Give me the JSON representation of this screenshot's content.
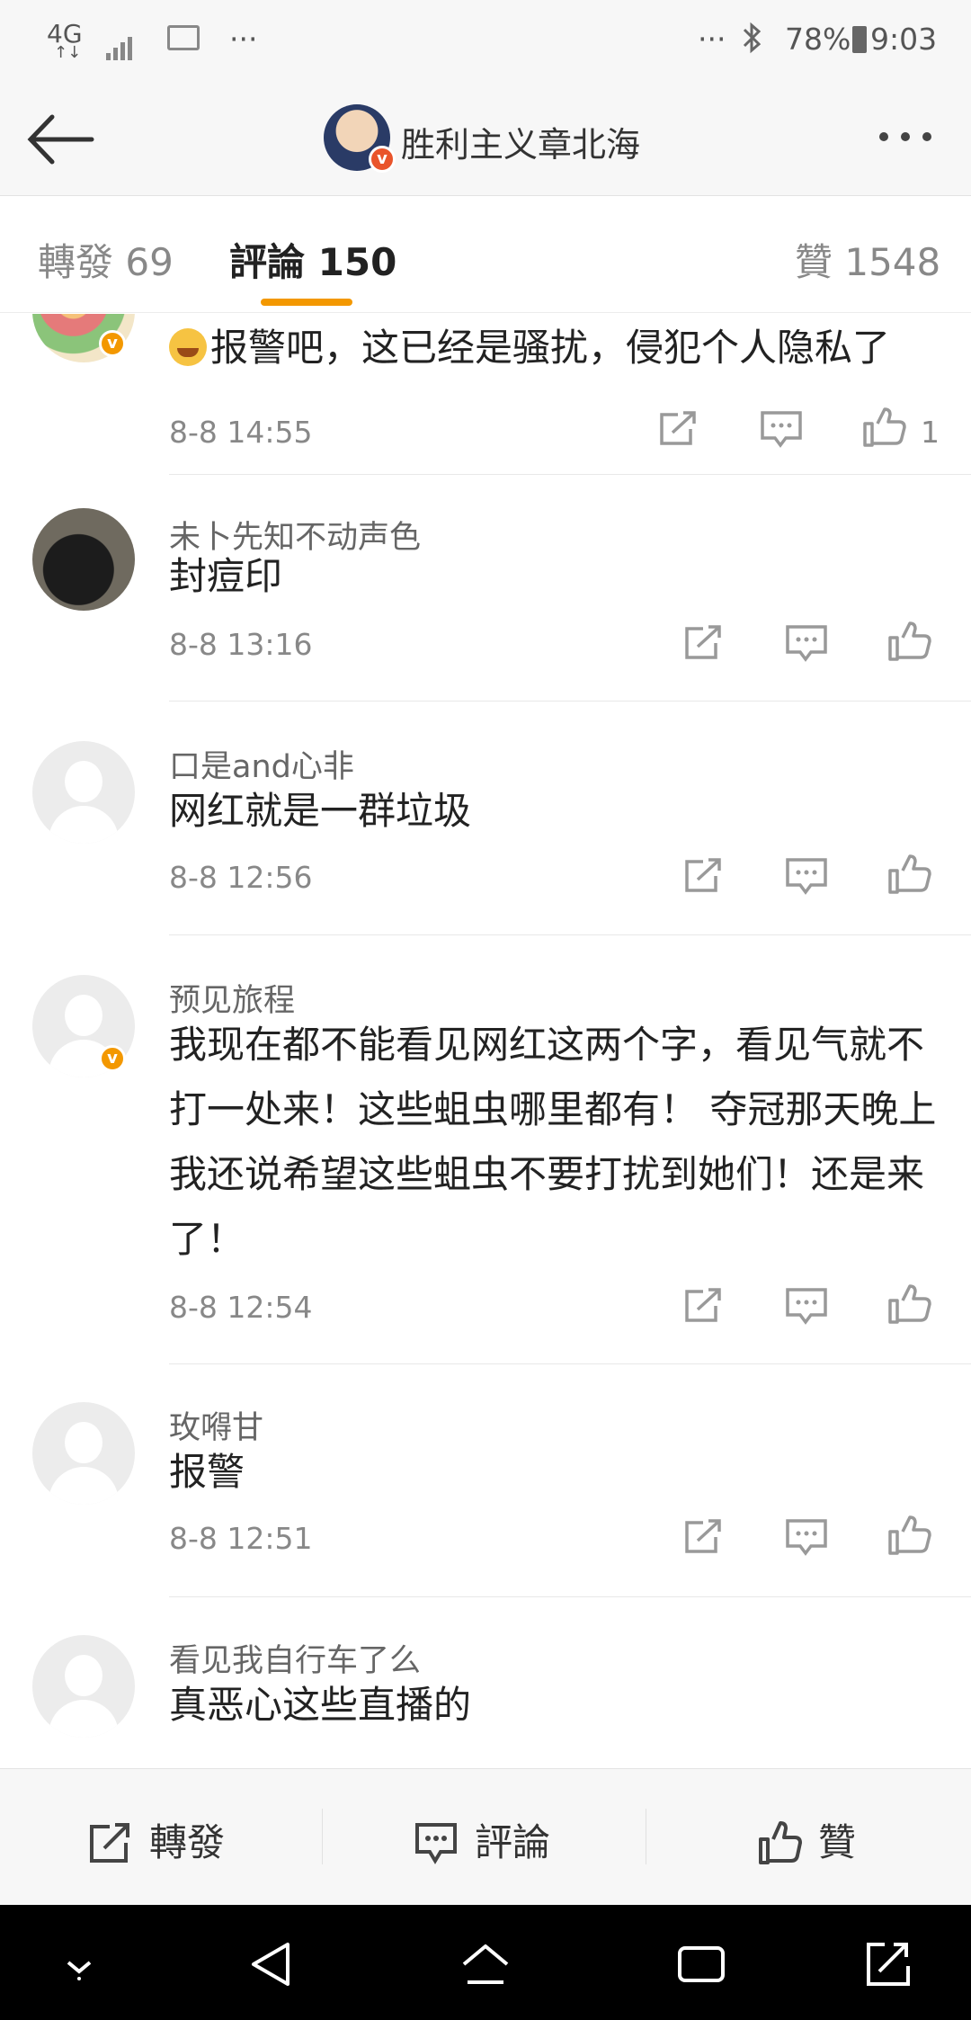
{
  "status_bar": {
    "network": "4G",
    "network_sub": "↑↓",
    "dots_left": "···",
    "dots_right": "···",
    "battery": "78%",
    "time": "9:03"
  },
  "header": {
    "title": "胜利主义章北海"
  },
  "tabs": [
    {
      "label": "轉發 69"
    },
    {
      "label": "評論 150"
    },
    {
      "label": "贊 1548"
    }
  ],
  "comments": [
    {
      "name": "",
      "text": "报警吧，这已经是骚扰，侵犯个人隐私了",
      "date": "8-8 14:55",
      "likes": "1",
      "verified": true,
      "avatar": "colorful"
    },
    {
      "name": "未卜先知不动声色",
      "text": "封痘印",
      "date": "8-8 13:16",
      "likes": "",
      "verified": false,
      "avatar": "cat"
    },
    {
      "name": "口是and心非",
      "text": "网红就是一群垃圾",
      "date": "8-8 12:56",
      "likes": "",
      "verified": false,
      "avatar": "default"
    },
    {
      "name": "预见旅程",
      "text": "我现在都不能看见网红这两个字，看见气就不打一处来！这些蛆虫哪里都有！ 夺冠那天晚上我还说希望这些蛆虫不要打扰到她们！还是来了！",
      "date": "8-8 12:54",
      "likes": "",
      "verified": true,
      "avatar": "default"
    },
    {
      "name": "玫嘚甘",
      "text": "报警",
      "date": "8-8 12:51",
      "likes": "",
      "verified": false,
      "avatar": "default"
    },
    {
      "name": "看见我自行车了么",
      "text": "真恶心这些直播的",
      "date": "",
      "likes": "",
      "verified": false,
      "avatar": "default"
    }
  ],
  "bottom_bar": {
    "repost": "轉發",
    "comment": "評論",
    "like": "贊"
  },
  "colors": {
    "accent": "#f39800",
    "badge_red": "#e9542b"
  }
}
